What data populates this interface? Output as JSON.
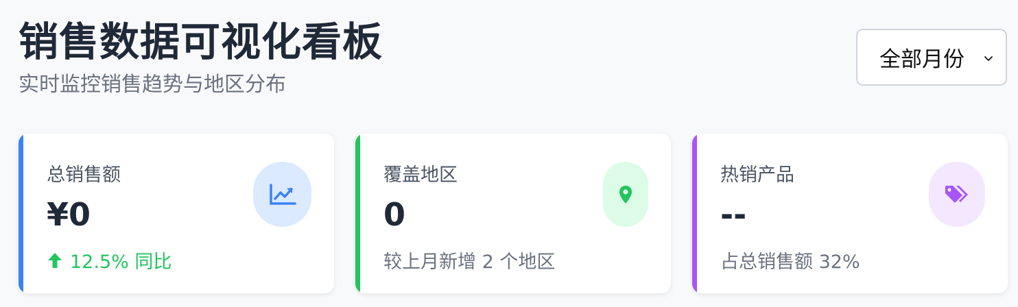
{
  "header": {
    "title": "销售数据可视化看板",
    "subtitle": "实时监控销售趋势与地区分布"
  },
  "month_filter": {
    "selected": "全部月份"
  },
  "cards": [
    {
      "label": "总销售额",
      "value": "¥0",
      "footer": "12.5% 同比",
      "trend": "up",
      "icon": "chart-line-up-icon",
      "accent": "#3b82f6",
      "icon_bg": "#dbeafe",
      "icon_color": "#3b82f6"
    },
    {
      "label": "覆盖地区",
      "value": "0",
      "footer": "较上月新增 2 个地区",
      "icon": "map-pin-icon",
      "accent": "#22c55e",
      "icon_bg": "#dcfce7",
      "icon_color": "#22c55e"
    },
    {
      "label": "热销产品",
      "value": "--",
      "footer": "占总销售额 32%",
      "icon": "tags-icon",
      "accent": "#a855f7",
      "icon_bg": "#f3e8ff",
      "icon_color": "#a855f7"
    }
  ]
}
